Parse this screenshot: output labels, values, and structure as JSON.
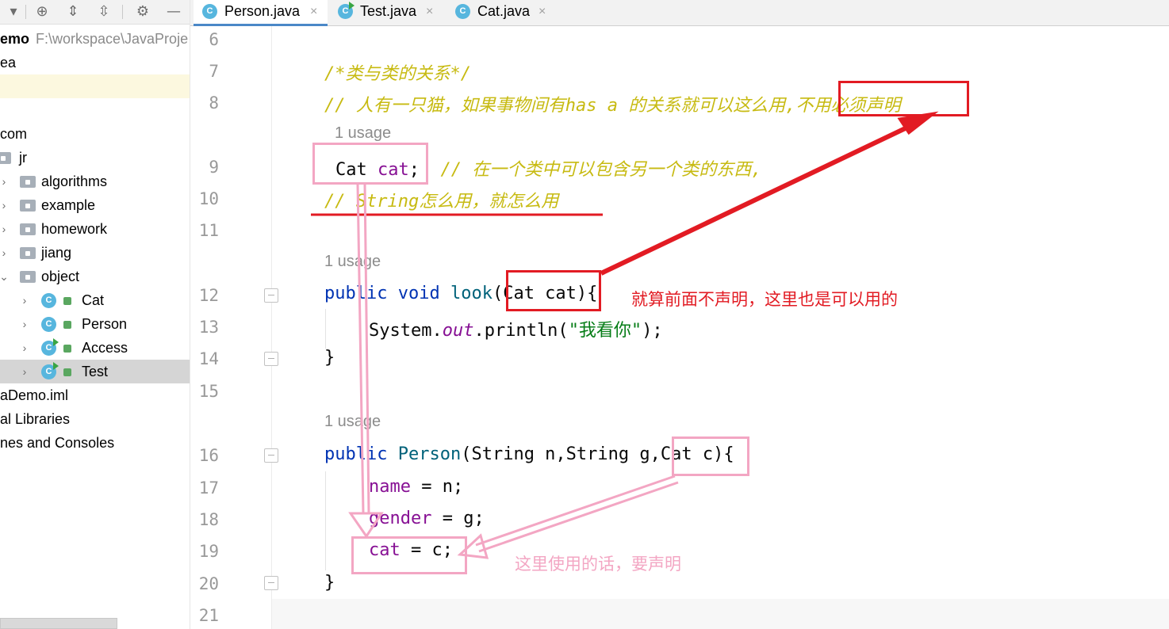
{
  "toolbar": {
    "icons": [
      "chevron-down-icon",
      "locate-icon",
      "expand-all-icon",
      "collapse-all-icon",
      "gear-icon",
      "minimize-icon"
    ]
  },
  "project_tree": {
    "root_name": "emo",
    "root_path": "F:\\workspace\\JavaProje",
    "items": [
      {
        "label": "ea"
      },
      {
        "label": ""
      },
      {
        "label": "com"
      },
      {
        "label": "jr"
      },
      {
        "label": "algorithms"
      },
      {
        "label": "example"
      },
      {
        "label": "homework"
      },
      {
        "label": "jiang"
      },
      {
        "label": "object"
      },
      {
        "label": "Cat"
      },
      {
        "label": "Person"
      },
      {
        "label": "Access"
      },
      {
        "label": "Test"
      },
      {
        "label": "aDemo.iml"
      },
      {
        "label": "al Libraries"
      },
      {
        "label": "nes and Consoles"
      }
    ],
    "class_icon_letter": "C"
  },
  "tabs": [
    {
      "label": "Person.java",
      "close": "×",
      "active": true
    },
    {
      "label": "Test.java",
      "close": "×",
      "active": false
    },
    {
      "label": "Cat.java",
      "close": "×",
      "active": false
    }
  ],
  "editor": {
    "line_numbers": [
      "6",
      "7",
      "8",
      "9",
      "10",
      "11",
      "12",
      "13",
      "14",
      "15",
      "16",
      "17",
      "18",
      "19",
      "20",
      "21"
    ],
    "usage_hint": "1 usage",
    "code": {
      "l7_comment": "/*类与类的关系*/",
      "l8_comment": "// 人有一只猫，如果事物间有has a 的关系就可以这么用,不用必须声明",
      "l9_type": "Cat",
      "l9_field": "cat",
      "l9_semicolon": ";",
      "l9_comment": "// 在一个类中可以包含另一个类的东西,",
      "l10_comment": "// String怎么用，就怎么用",
      "l12_public": "public",
      "l12_void": "void",
      "l12_method": "look",
      "l12_params": "(Cat cat)",
      "l12_brace": "{",
      "l13_system": "System.",
      "l13_out": "out",
      "l13_println": ".println(",
      "l13_string": "\"我看你\"",
      "l13_end": ");",
      "l14_brace": "}",
      "l16_public": "public",
      "l16_ctor": "Person",
      "l16_params": "(String n,String g,Cat c)",
      "l16_brace": "{",
      "l17_field": "name",
      "l17_rest": " = n;",
      "l18_field": "gender",
      "l18_rest": " = g;",
      "l19_field": "cat",
      "l19_rest": " = c;",
      "l20_brace": "}"
    }
  },
  "annotations": {
    "red_note": "就算前面不声明，这里也是可以用的",
    "pink_note": "这里使用的话，要声明",
    "red_color": "#e21b23",
    "pink_color": "#f3a6c3"
  },
  "colors": {
    "keyword": "#0033b3",
    "method": "#00627a",
    "field": "#871094",
    "string": "#067d17",
    "comment": "#c7ba11",
    "active_tab_underline": "#4a88c7"
  }
}
